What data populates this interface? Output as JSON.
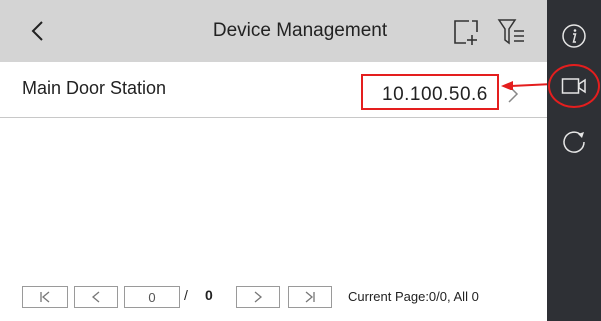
{
  "header": {
    "title": "Device Management",
    "back_icon": "chevron-left-icon",
    "add_icon": "add-device-icon",
    "filter_icon": "filter-list-icon"
  },
  "devices": [
    {
      "name": "Main Door Station",
      "ip": "10.100.50.6"
    }
  ],
  "pagination": {
    "current_input": "0",
    "separator": "/",
    "total": "0",
    "status": "Current Page:0/0, All 0"
  },
  "sidebar": {
    "items": [
      {
        "icon": "info-icon"
      },
      {
        "icon": "video-icon"
      },
      {
        "icon": "refresh-icon"
      }
    ]
  },
  "colors": {
    "header_bg": "#d4d4d4",
    "sidebar_bg": "#2e3035",
    "annotation": "#e41e1e"
  }
}
